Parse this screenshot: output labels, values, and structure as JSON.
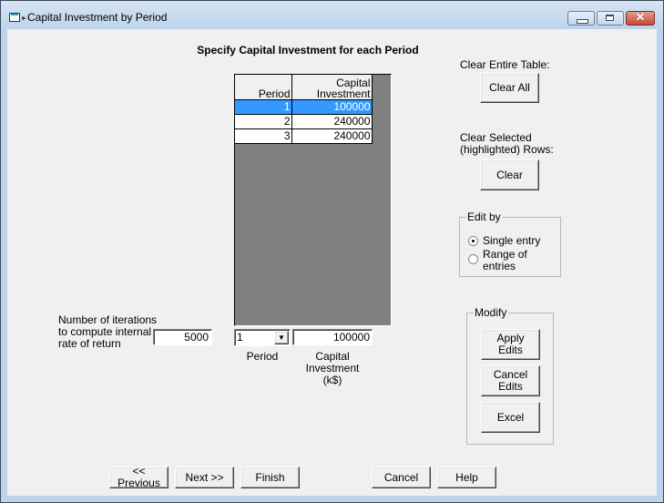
{
  "window": {
    "title": "Capital Investment by Period",
    "controls": {
      "minimize": "minimize",
      "maximize": "maximize",
      "close": "✕"
    }
  },
  "heading": "Specify Capital Investment for each Period",
  "table": {
    "columns": [
      "Period",
      "Capital Investment"
    ],
    "rows": [
      {
        "period": "1",
        "investment": "100000",
        "selected": true
      },
      {
        "period": "2",
        "investment": "240000",
        "selected": false
      },
      {
        "period": "3",
        "investment": "240000",
        "selected": false
      }
    ],
    "selection_color": "#3399ff"
  },
  "clear_all": {
    "label": "Clear Entire Table:",
    "button": "Clear All"
  },
  "clear_selected": {
    "label_line1": "Clear Selected",
    "label_line2": "(highlighted) Rows:",
    "button": "Clear"
  },
  "edit_by": {
    "title": "Edit by",
    "options": [
      {
        "label_line1": "Single entry",
        "label_line2": "",
        "checked": true
      },
      {
        "label_line1": "Range of",
        "label_line2": "entries",
        "checked": false
      }
    ]
  },
  "modify": {
    "title": "Modify",
    "apply_line1": "Apply",
    "apply_line2": "Edits",
    "cancel_line1": "Cancel",
    "cancel_line2": "Edits",
    "excel": "Excel"
  },
  "iterations": {
    "label_line1": "Number of iterations",
    "label_line2": "to compute internal",
    "label_line3": "rate of return",
    "value": "5000"
  },
  "editor": {
    "period_value": "1",
    "period_label": "Period",
    "investment_value": "100000",
    "investment_label_line1": "Capital",
    "investment_label_line2": "Investment",
    "investment_label_line3": "(k$)"
  },
  "footer": {
    "previous": "<< Previous",
    "next": "Next >>",
    "finish": "Finish",
    "cancel": "Cancel",
    "help": "Help"
  }
}
